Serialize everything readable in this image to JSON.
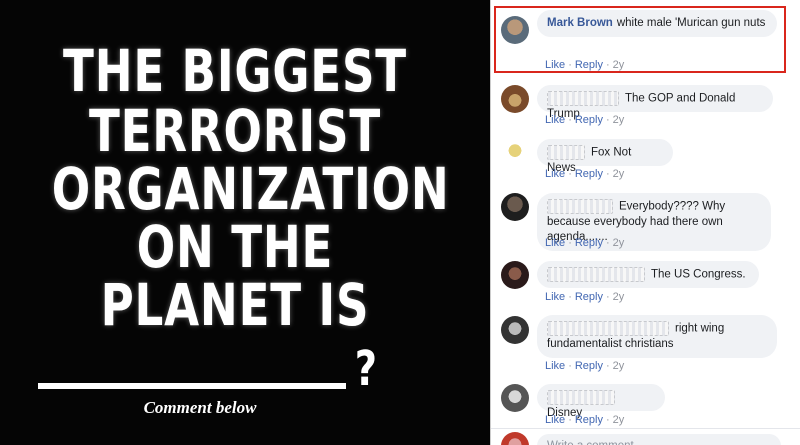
{
  "meme": {
    "lines": [
      "THE BIGGEST",
      "TERRORIST",
      "ORGANIZATION",
      "ON THE",
      "PLANET IS"
    ],
    "question_mark": "?",
    "caption": "Comment below"
  },
  "comments": [
    {
      "author": "Mark Brown",
      "text": "white male 'Murican gun nuts",
      "like": "Like",
      "reply": "Reply",
      "time": "2y"
    },
    {
      "text": "The GOP and Donald Trump",
      "like": "Like",
      "reply": "Reply",
      "time": "2y"
    },
    {
      "text": "Fox Not News",
      "like": "Like",
      "reply": "Reply",
      "time": "2y"
    },
    {
      "text": "Everybody???? Why because everybody had there own agenda.......",
      "like": "Like",
      "reply": "Reply",
      "time": "2y"
    },
    {
      "text": "The US Congress.",
      "like": "Like",
      "reply": "Reply",
      "time": "2y"
    },
    {
      "text": "right wing fundamentalist christians",
      "like": "Like",
      "reply": "Reply",
      "time": "2y"
    },
    {
      "text": "Disney",
      "like": "Like",
      "reply": "Reply",
      "time": "2y"
    }
  ],
  "composer": {
    "placeholder": "Write a comment..."
  },
  "colors": {
    "highlight": "#d9261c",
    "link": "#4267b2",
    "author": "#385898"
  }
}
